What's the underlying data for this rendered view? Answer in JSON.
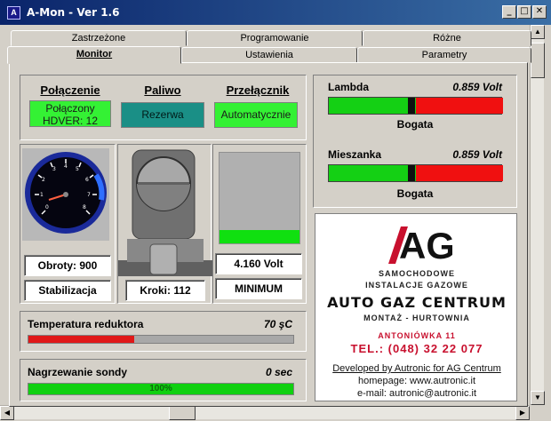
{
  "window": {
    "title": "A-Mon - Ver 1.6",
    "icon_letter": "A"
  },
  "tabs_back": [
    "Zastrzeżone",
    "Programowanie",
    "Różne"
  ],
  "tabs_front": [
    "Monitor",
    "Ustawienia",
    "Parametry"
  ],
  "status": {
    "connection_header": "Połączenie",
    "connection_line1": "Połączony",
    "connection_line2": "HDVER: 12",
    "fuel_header": "Paliwo",
    "fuel_value": "Rezerwa",
    "switch_header": "Przełącznik",
    "switch_value": "Automatycznie"
  },
  "gauges": {
    "rpm_value": "Obroty: 900",
    "rpm_state": "Stabilizacja",
    "steps_value": "Kroki: 112",
    "volt_value": "4.160 Volt",
    "volt_state": "MINIMUM",
    "level_fill": 0.15
  },
  "lambda": {
    "label": "Lambda",
    "value": "0.859 Volt",
    "state": "Bogata",
    "marker": 0.46
  },
  "mixture": {
    "label": "Mieszanka",
    "value": "0.859 Volt",
    "state": "Bogata",
    "marker": 0.46
  },
  "temperature": {
    "label": "Temperatura reduktora",
    "value": "70 şC",
    "fill": 0.4
  },
  "probe": {
    "label": "Nagrzewanie sondy",
    "value": "0 sec",
    "percent": "100%",
    "fill": 1.0
  },
  "logo": {
    "brand": "AG",
    "line1": "SAMOCHODOWE",
    "line2": "INSTALACJE GAZOWE",
    "company": "AUTO GAZ CENTRUM",
    "services": "MONTAŻ - HURTOWNIA",
    "address": "ANTONIÓWKA 11",
    "phone": "TEL.: (048) 32 22 077",
    "dev": "Developed by Autronic for AG Centrum",
    "homepage": "homepage: www.autronic.it",
    "email": "e-mail: autronic@autronic.it"
  },
  "colors": {
    "lcd_green": "#34f134",
    "rich_red": "#f01010",
    "bar_green": "#10d010",
    "temp_red": "#e01818",
    "title_blue": "#0a246a"
  }
}
